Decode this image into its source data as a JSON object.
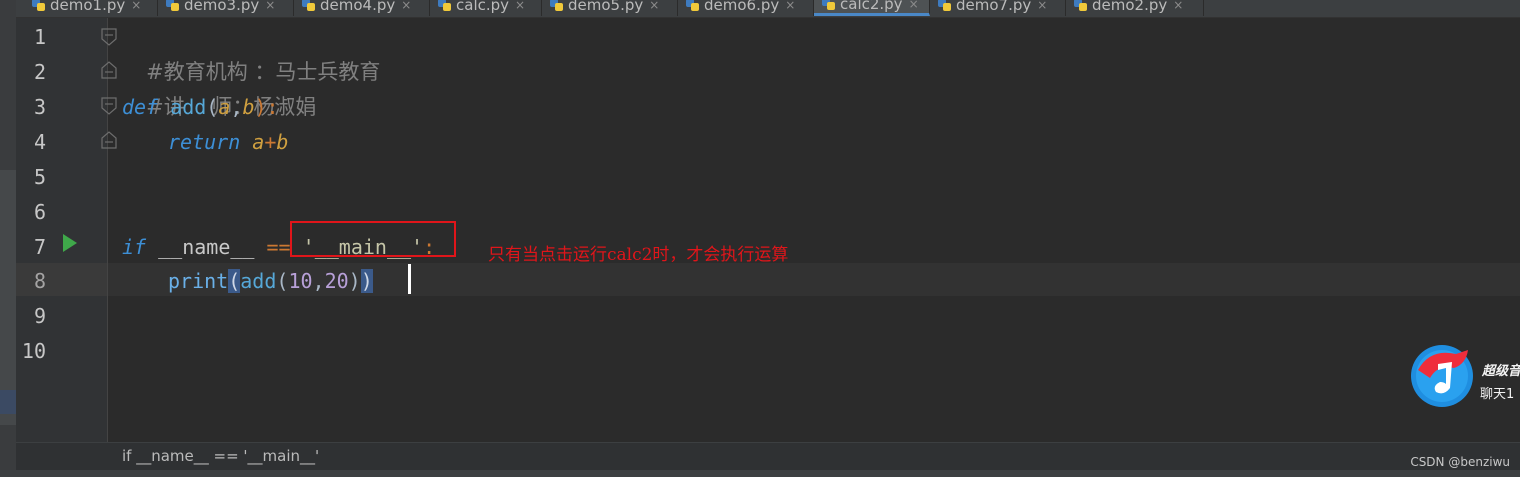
{
  "tabs": [
    {
      "label": "demo1.py",
      "active": false
    },
    {
      "label": "demo3.py",
      "active": false
    },
    {
      "label": "demo4.py",
      "active": false
    },
    {
      "label": "calc.py",
      "active": false
    },
    {
      "label": "demo5.py",
      "active": false
    },
    {
      "label": "demo6.py",
      "active": false
    },
    {
      "label": "calc2.py",
      "active": true
    },
    {
      "label": "demo7.py",
      "active": false
    },
    {
      "label": "demo2.py",
      "active": false
    }
  ],
  "tab_close_glyph": "×",
  "line_numbers": [
    "1",
    "2",
    "3",
    "4",
    "5",
    "6",
    "7",
    "8",
    "9",
    "10"
  ],
  "code": {
    "line1": "#教育机构 ：马士兵教育",
    "line2": "#讲    师：杨淑娟",
    "line3": {
      "kw": "def",
      "name": "add",
      "open": "(",
      "p1": "a",
      "comma": ",",
      "p2": "b",
      "close": "):"
    },
    "line4": {
      "kw": "return",
      "p1": "a",
      "op": "+",
      "p2": "b"
    },
    "line7": {
      "kw": "if",
      "var": "__name__",
      "op": "==",
      "str": "'__main__'",
      "colon": ":"
    },
    "line8": {
      "fn": "print",
      "open": "(",
      "inner_fn": "add",
      "inner_open": "(",
      "n1": "10",
      "comma": ",",
      "n2": "20",
      "inner_close": ")",
      "close": ")"
    }
  },
  "annotation": "只有当点击运行calc2时，才会执行运算",
  "statusbar": {
    "breadcrumb": "if __name__ == '__main__'",
    "watermark": "CSDN @benziwu"
  },
  "overlay_logo": {
    "text1": "超级音",
    "text2": "聊天1"
  },
  "colors": {
    "editor_bg": "#2b2b2b",
    "keyword": "#3d8fd6",
    "param": "#d0a040",
    "annotation": "#e0151a",
    "active_tab_underline": "#4a88c7"
  }
}
